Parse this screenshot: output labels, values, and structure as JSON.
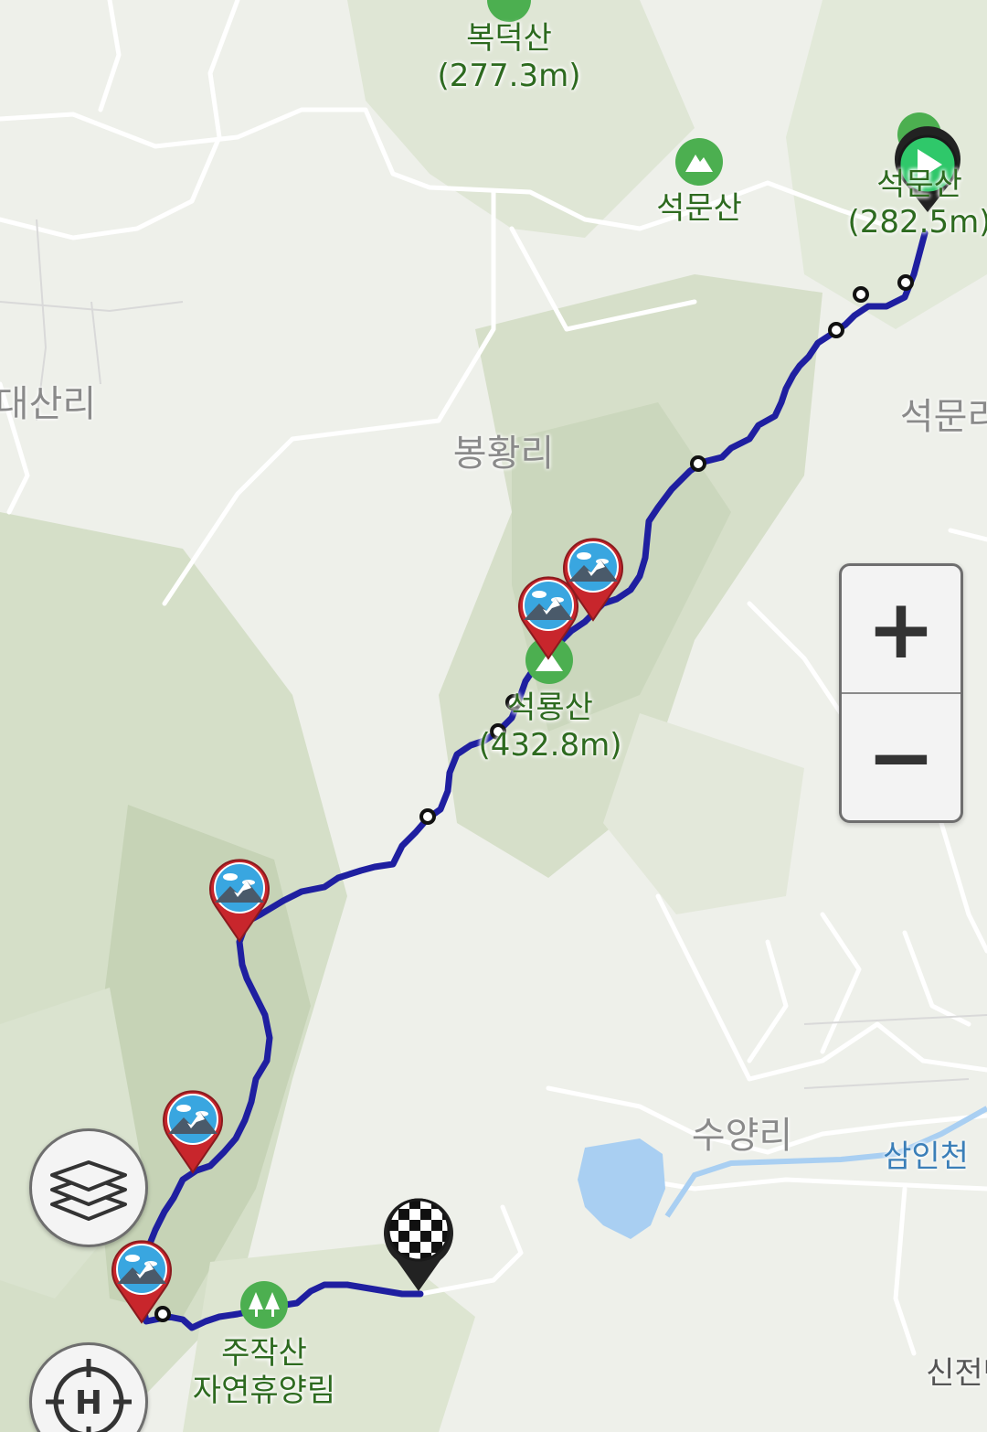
{
  "map": {
    "peaks": [
      {
        "name": "복덕산",
        "elevation": "(277.3m)"
      },
      {
        "name": "석문산",
        "elevation": ""
      },
      {
        "name": "석문산",
        "elevation": "(282.5m)"
      },
      {
        "name": "석룡산",
        "elevation": "(432.8m)"
      },
      {
        "name": "주작산",
        "elevation": "자연휴양림"
      }
    ],
    "villages": [
      "대산리",
      "봉황리",
      "석문리",
      "수양리",
      "신전면"
    ],
    "streams": [
      "삼인천"
    ]
  },
  "controls": {
    "zoom_in": "+",
    "zoom_out": "−",
    "layers": "layers",
    "locate": "H"
  },
  "route": {
    "color": "#1f1fa0",
    "start_icon": "play-icon",
    "finish_icon": "checkered-flag-icon"
  }
}
